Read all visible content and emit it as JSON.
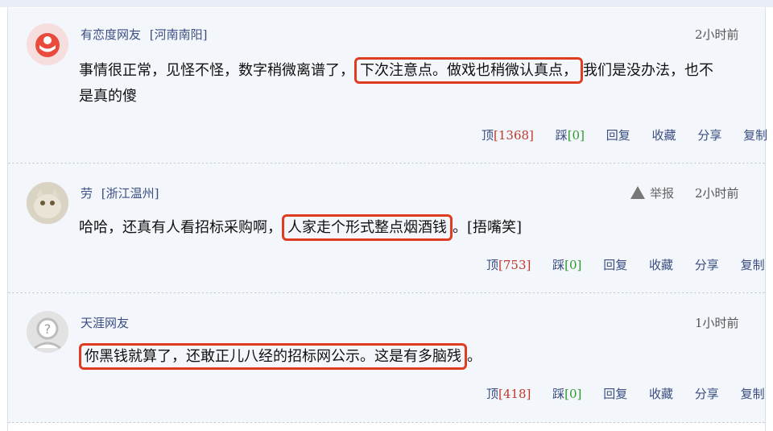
{
  "comments": [
    {
      "name": "有恋度网友",
      "location": "[河南南阳]",
      "time": "2小时前",
      "text_before": "事情很正常，见怪不怪，数字稍微离谱了，",
      "text_highlight": "下次注意点。做戏也稍微认真点，",
      "text_after_line1": "我们是没办法，也不",
      "text_line2": "是真的傻",
      "actions": {
        "up_label": "顶",
        "up_count": "[1368]",
        "down_label": "踩",
        "down_count": "[0]",
        "reply": "回复",
        "fav": "收藏",
        "share": "分享",
        "copy": "复制"
      }
    },
    {
      "name": "劳",
      "location": "[浙江温州]",
      "time": "2小时前",
      "report": "举报",
      "text_before": "哈哈，还真有人看招标采购啊，",
      "text_highlight": "人家走个形式整点烟酒钱",
      "text_after": "。[捂嘴笑]",
      "actions": {
        "up_label": "顶",
        "up_count": "[753]",
        "down_label": "踩",
        "down_count": "[0]",
        "reply": "回复",
        "fav": "收藏",
        "share": "分享",
        "copy": "复制"
      }
    },
    {
      "name": "天涯网友",
      "time": "1小时前",
      "text_highlight": "你黑钱就算了，还敢正儿八经的招标网公示。这是有多脑残",
      "text_after": "。",
      "actions": {
        "up_label": "顶",
        "up_count": "[418]",
        "down_label": "踩",
        "down_count": "[0]",
        "reply": "回复",
        "fav": "收藏",
        "share": "分享",
        "copy": "复制"
      }
    }
  ],
  "colors": {
    "accent": "#3a4e82",
    "highlight_border": "#e03c22",
    "up_count": "#c0392b",
    "down_count": "#2e9a2e",
    "background": "#f3f6fb"
  }
}
